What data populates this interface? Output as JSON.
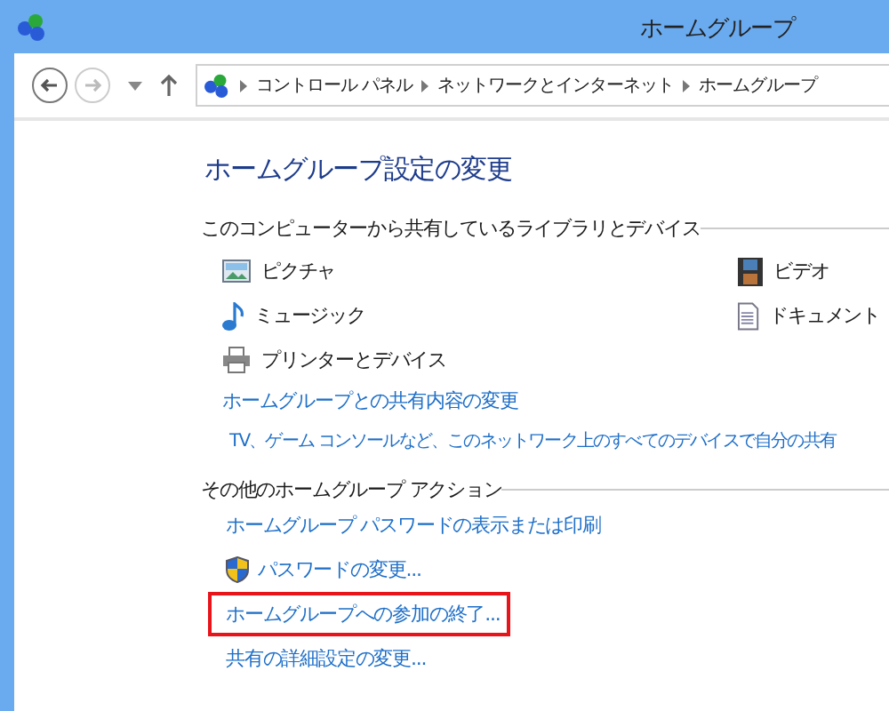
{
  "window": {
    "title": "ホームグループ"
  },
  "address_bar": {
    "breadcrumbs": [
      "コントロール パネル",
      "ネットワークとインターネット",
      "ホームグループ"
    ]
  },
  "heading": "ホームグループ設定の変更",
  "shared_section": {
    "title": "このコンピューターから共有しているライブラリとデバイス",
    "items": [
      {
        "label": "ピクチャ",
        "kind": "pictures"
      },
      {
        "label": "ビデオ",
        "kind": "videos"
      },
      {
        "label": "ミュージック",
        "kind": "music"
      },
      {
        "label": "ドキュメント",
        "kind": "documents"
      },
      {
        "label": "プリンターとデバイス",
        "kind": "printers"
      }
    ],
    "links": [
      "ホームグループとの共有内容の変更",
      "TV、ゲーム コンソールなど、このネットワーク上のすべてのデバイスで自分の共有"
    ]
  },
  "actions_section": {
    "title": "その他のホームグループ アクション",
    "links": [
      {
        "label": "ホームグループ パスワードの表示または印刷",
        "shield": false,
        "highlighted": false
      },
      {
        "label": "パスワードの変更...",
        "shield": true,
        "highlighted": false
      },
      {
        "label": "ホームグループへの参加の終了...",
        "shield": false,
        "highlighted": true
      },
      {
        "label": "共有の詳細設定の変更...",
        "shield": false,
        "highlighted": false
      }
    ]
  }
}
